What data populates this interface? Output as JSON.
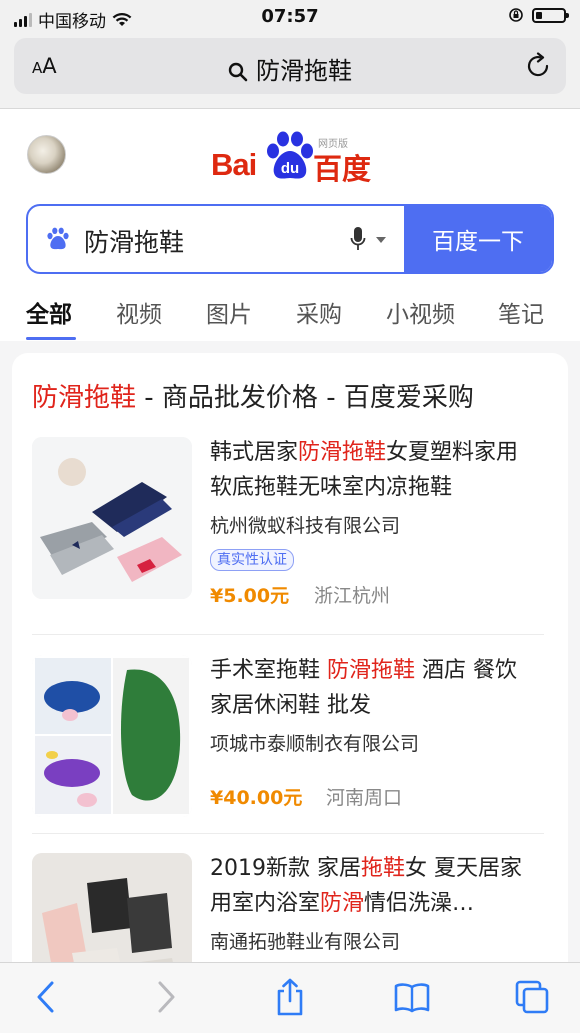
{
  "status_bar": {
    "carrier": "中国移动",
    "time": "07:57"
  },
  "address_bar": {
    "aa_label_small": "A",
    "aa_label_large": "A",
    "query": "防滑拖鞋"
  },
  "baidu": {
    "logo_bai": "Bai",
    "logo_du": "du",
    "logo_cn": "百度",
    "logo_tag": "网页版",
    "search_value": "防滑拖鞋",
    "search_button": "百度一下"
  },
  "tabs": [
    {
      "label": "全部",
      "active": true
    },
    {
      "label": "视频"
    },
    {
      "label": "图片"
    },
    {
      "label": "采购"
    },
    {
      "label": "小视频"
    },
    {
      "label": "笔记"
    }
  ],
  "result_card": {
    "title_highlight": "防滑拖鞋",
    "title_rest": " - 商品批发价格 - 百度爱采购",
    "items": [
      {
        "title_parts": [
          "韩式居家",
          "防滑拖鞋",
          "女夏塑料家用软底拖鞋无味室内凉拖鞋"
        ],
        "company": "杭州微蚁科技有限公司",
        "badge": "真实性认证",
        "price": "¥5.00元",
        "location": "浙江杭州"
      },
      {
        "title_parts": [
          "手术室拖鞋 ",
          "防滑拖鞋",
          " 酒店 餐饮 家居休闲鞋 批发"
        ],
        "company": "项城市泰顺制衣有限公司",
        "price": "¥40.00元",
        "location": "河南周口"
      },
      {
        "title_parts": [
          "2019新款 家居",
          "拖鞋",
          "女 夏天居家用室内浴室",
          "防滑",
          "情侣洗澡…"
        ],
        "company": "南通拓驰鞋业有限公司"
      }
    ]
  },
  "colors": {
    "baidu_blue": "#4e6ef2",
    "baidu_red": "#de2910",
    "highlight_red": "#e0241b",
    "price_orange": "#f08a00"
  },
  "toolbar_icons": [
    "back-icon",
    "forward-icon",
    "share-icon",
    "bookmarks-icon",
    "tabs-icon"
  ]
}
